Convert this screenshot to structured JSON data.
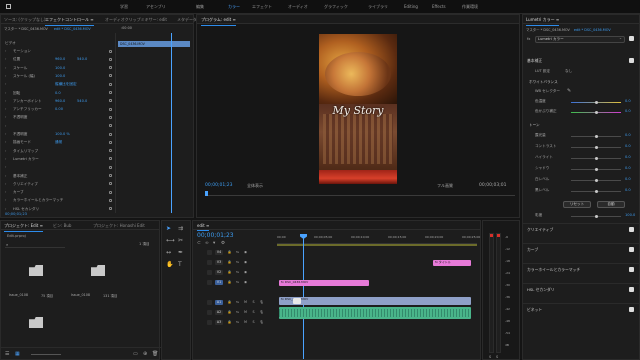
{
  "workspace_tabs": [
    "学習",
    "アセンブリ",
    "編集",
    "カラー",
    "エフェクト",
    "オーディオ",
    "グラフィック",
    "ライブラリ",
    "Editing",
    "Effects",
    "作業環境"
  ],
  "effect_controls": {
    "tabs": [
      "ソース: (クリップなし)",
      "エフェクトコントロール ≡",
      "オーディオクリップミキサー: edit",
      "メタデータ"
    ],
    "breadcrumb_master": "マスター * DSC_0436.MOV",
    "breadcrumb_clip": "edit * DSC_0436.MOV",
    "timecode_header": ":00:00",
    "clip_label": "DSC_0436.MOV",
    "section_video": "ビデオ",
    "rows": [
      {
        "label": "モーション",
        "value": ""
      },
      {
        "label": "位置",
        "value": "960.0",
        "value2": "540.0"
      },
      {
        "label": "スケール",
        "value": "100.0",
        "value2": ""
      },
      {
        "label": "スケール (幅)",
        "value": "100.0",
        "value2": ""
      },
      {
        "label": "",
        "value": "縦横比を固定",
        "value2": ""
      },
      {
        "label": "回転",
        "value": "0.0",
        "value2": ""
      },
      {
        "label": "アンカーポイント",
        "value": "960.0",
        "value2": "540.0"
      },
      {
        "label": "アンチフリッカー",
        "value": "0.00",
        "value2": ""
      },
      {
        "label": "不透明度",
        "value": "",
        "value2": ""
      },
      {
        "label": "",
        "value": "",
        "value2": ""
      },
      {
        "label": "不透明度",
        "value": "100.0 %",
        "value2": ""
      },
      {
        "label": "描画モード",
        "value": "通常",
        "value2": ""
      },
      {
        "label": "タイムリマップ",
        "value": "",
        "value2": ""
      },
      {
        "label": "Lumetri カラー",
        "value": "",
        "value2": ""
      },
      {
        "label": "",
        "value": "",
        "value2": ""
      },
      {
        "label": "基本補正",
        "value": "",
        "value2": ""
      },
      {
        "label": "クリエイティブ",
        "value": "",
        "value2": ""
      },
      {
        "label": "カーブ",
        "value": "",
        "value2": ""
      },
      {
        "label": "カラーホイールとカラーマッチ",
        "value": "",
        "value2": ""
      },
      {
        "label": "HSL セカンダリ",
        "value": "",
        "value2": ""
      }
    ],
    "bottom_timecode": "00;00;01;23"
  },
  "program_monitor": {
    "title": "プログラム: edit ≡",
    "overlay_text": "My Story",
    "timecode_left": "00;00;01;23",
    "fit_label": "全体表示",
    "quality_label": "フル画質",
    "timecode_right": "00;00;03;01"
  },
  "lumetri": {
    "title": "Lumetri カラー ≡",
    "master_label": "マスター * DSC_0436.MOV",
    "clip_label": "edit * DSC_0436.MOV",
    "fx_label": "fx",
    "dropdown_value": "Lumetri カラー",
    "section_basic": "基本補正",
    "lut_label": "LUT 設定",
    "lut_value": "なし",
    "wb_section": "ホワイトバランス",
    "wb_picker": "WB セレクター",
    "sliders": [
      {
        "label": "色温度",
        "value": "0.0",
        "pos": 0.5,
        "gradient": "linear-gradient(90deg,#3a6fd8,#e0c03a)"
      },
      {
        "label": "色かぶり補正",
        "value": "0.0",
        "pos": 0.5,
        "gradient": "linear-gradient(90deg,#3dbf4a,#d23ad0)"
      }
    ],
    "tone_section": "トーン",
    "tone_sliders": [
      {
        "label": "露光量",
        "value": "0.0",
        "pos": 0.5
      },
      {
        "label": "コントラスト",
        "value": "0.0",
        "pos": 0.5
      },
      {
        "label": "ハイライト",
        "value": "0.0",
        "pos": 0.5
      },
      {
        "label": "シャドウ",
        "value": "0.0",
        "pos": 0.5
      },
      {
        "label": "白レベル",
        "value": "0.0",
        "pos": 0.5
      },
      {
        "label": "黒レベル",
        "value": "0.0",
        "pos": 0.5
      }
    ],
    "reset_button": "リセット",
    "auto_button": "自動",
    "saturation_label": "彩度",
    "saturation_value": "100.0",
    "collapsed_sections": [
      "クリエイティブ",
      "カーブ",
      "カラーホイールとカラーマッチ",
      "HSL セカンダリ",
      "ビネット"
    ]
  },
  "project_panel": {
    "tabs": [
      "プロジェクト: Edit ≡",
      "ビン: Bub",
      "プロジェクト: Honashi Edit"
    ],
    "path": "Edit.prproj",
    "count": "1 項目",
    "items": [
      {
        "name": "Issue_0108",
        "meta": "75 項目"
      },
      {
        "name": "Issue_0108",
        "meta": "131 項目"
      },
      {
        "name": "",
        "meta": ""
      }
    ]
  },
  "timeline": {
    "title": "edit ≡",
    "timecode": "00;00;01;23",
    "ruler_labels": [
      "00;00",
      "00;00;05;00",
      "00;00;10;00",
      "00;00;15;00",
      "00;00;20;00",
      "00;00;25;00"
    ],
    "tracks": [
      {
        "id": "V4",
        "kind": "video"
      },
      {
        "id": "V3",
        "kind": "video"
      },
      {
        "id": "V2",
        "kind": "video"
      },
      {
        "id": "V1",
        "kind": "video"
      },
      {
        "id": "A1",
        "kind": "audio"
      },
      {
        "id": "A2",
        "kind": "audio"
      },
      {
        "id": "A3",
        "kind": "audio"
      }
    ],
    "clips": [
      {
        "label": "fx タイトル",
        "color": "#e77ad8"
      },
      {
        "label": "fx DSC_0436.MOV",
        "color": "#e77ad8"
      },
      {
        "label": "fx DSC_0436.MOV",
        "color": "#8fa0c8"
      },
      {
        "label": "",
        "color": "#49b58a"
      }
    ],
    "meter_labels": [
      "-6",
      "-12",
      "-18",
      "-24",
      "-30",
      "-36",
      "-42",
      "-48",
      "-54",
      "dB"
    ]
  },
  "colors": {
    "accent": "#2d8ceb",
    "playhead": "#4aa3ff",
    "pink_clip": "#e77ad8",
    "blue_clip": "#8fa0c8",
    "green_audio": "#49b58a"
  }
}
